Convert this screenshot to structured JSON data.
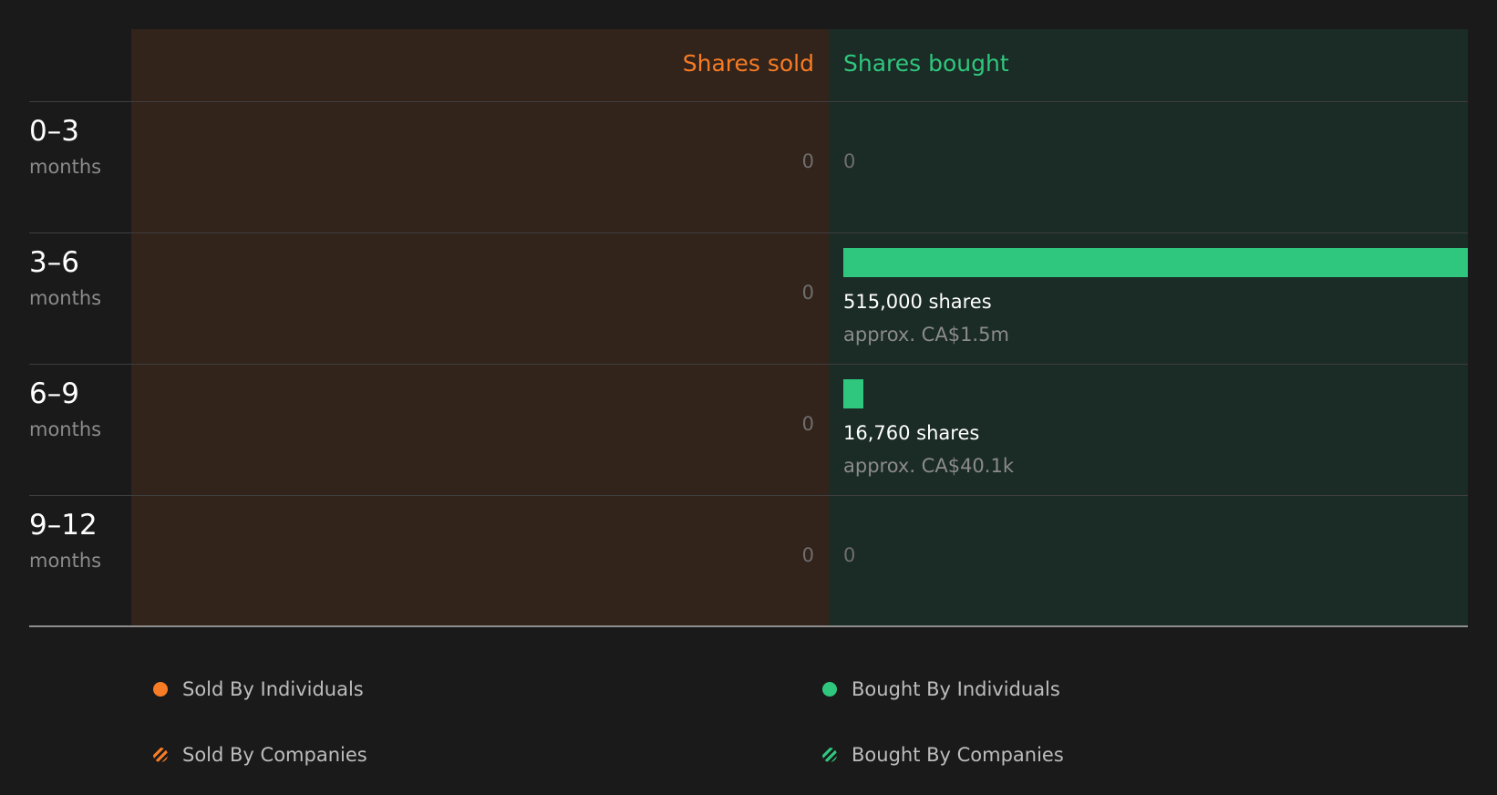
{
  "colors": {
    "sold": "#f77c25",
    "bought": "#2fc77e",
    "background": "#1a1a1a",
    "sold_bg": "#32231b",
    "bought_bg": "#1b2b25"
  },
  "chart_data": {
    "type": "bar",
    "headers": {
      "sold": "Shares sold",
      "bought": "Shares bought"
    },
    "categories": [
      {
        "period": "0–3",
        "unit": "months"
      },
      {
        "period": "3–6",
        "unit": "months"
      },
      {
        "period": "6–9",
        "unit": "months"
      },
      {
        "period": "9–12",
        "unit": "months"
      }
    ],
    "series": [
      {
        "name": "Shares sold",
        "values": [
          0,
          0,
          0,
          0
        ],
        "labels": [
          "0",
          "0",
          "0",
          "0"
        ]
      },
      {
        "name": "Shares bought",
        "values": [
          0,
          515000,
          16760,
          0
        ],
        "labels": [
          "0",
          "515,000 shares",
          "16,760 shares",
          "0"
        ],
        "approx": [
          "",
          "approx. CA$1.5m",
          "approx. CA$40.1k",
          ""
        ]
      }
    ],
    "xlim": [
      0,
      515000
    ],
    "legend": [
      {
        "label": "Sold By Individuals",
        "icon": "solid-dot",
        "color": "#f77c25"
      },
      {
        "label": "Bought By Individuals",
        "icon": "solid-dot",
        "color": "#2fc77e"
      },
      {
        "label": "Sold By Companies",
        "icon": "hatched-dot",
        "color": "#f77c25"
      },
      {
        "label": "Bought By Companies",
        "icon": "hatched-dot",
        "color": "#2fc77e"
      }
    ],
    "legend_position": "bottom"
  }
}
